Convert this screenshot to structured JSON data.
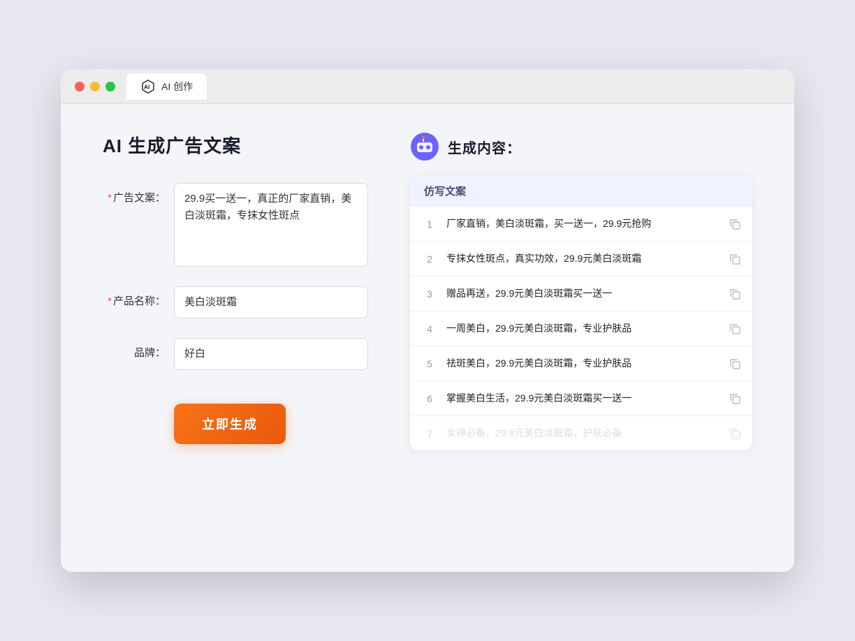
{
  "browser": {
    "tab_label": "AI 创作"
  },
  "page": {
    "title": "AI 生成广告文案"
  },
  "form": {
    "ad_copy_label": "广告文案：",
    "ad_copy_required": "*",
    "ad_copy_value": "29.9买一送一，真正的厂家直销，美白淡斑霜，专抹女性斑点",
    "product_name_label": "产品名称：",
    "product_name_required": "*",
    "product_name_value": "美白淡斑霜",
    "brand_label": "品牌：",
    "brand_value": "好白",
    "generate_btn": "立即生成"
  },
  "result": {
    "header": "生成内容：",
    "column_label": "仿写文案",
    "rows": [
      {
        "num": "1",
        "text": "厂家直销，美白淡斑霜，买一送一，29.9元抢购",
        "faded": false
      },
      {
        "num": "2",
        "text": "专抹女性斑点，真实功效，29.9元美白淡斑霜",
        "faded": false
      },
      {
        "num": "3",
        "text": "赠品再送，29.9元美白淡斑霜买一送一",
        "faded": false
      },
      {
        "num": "4",
        "text": "一周美白，29.9元美白淡斑霜，专业护肤品",
        "faded": false
      },
      {
        "num": "5",
        "text": "祛斑美白，29.9元美白淡斑霜，专业护肤品",
        "faded": false
      },
      {
        "num": "6",
        "text": "掌握美白生活，29.9元美白淡斑霜买一送一",
        "faded": false
      },
      {
        "num": "7",
        "text": "女神必备，29.9元美白淡斑霜，护肤必备",
        "faded": true
      }
    ]
  }
}
